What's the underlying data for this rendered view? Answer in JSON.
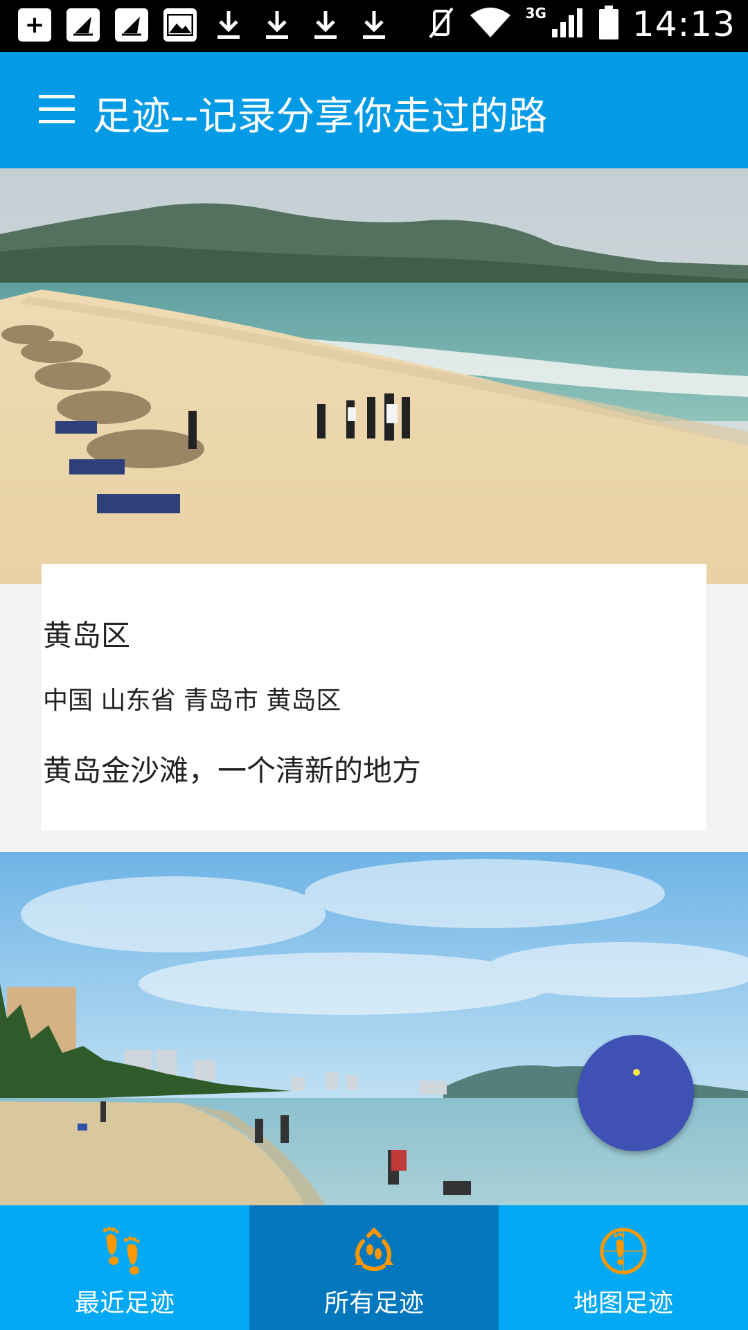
{
  "status_bar": {
    "time": "14:13",
    "network": "3G",
    "notification_icons": [
      "add-icon",
      "sailing-icon",
      "sailing-icon",
      "image-icon",
      "download-icon",
      "download-icon",
      "download-icon",
      "download-icon"
    ]
  },
  "app_bar": {
    "title": "足迹--记录分享你走过的路"
  },
  "cards": [
    {
      "title": "黄岛区",
      "address": "中国 山东省 青岛市 黄岛区",
      "description": "黄岛金沙滩，一个清新的地方"
    }
  ],
  "bottom_nav": {
    "items": [
      {
        "label": "最近足迹",
        "icon": "footprints-icon",
        "active": false
      },
      {
        "label": "所有足迹",
        "icon": "recycle-footprints-icon",
        "active": true
      },
      {
        "label": "地图足迹",
        "icon": "map-footprint-icon",
        "active": false
      }
    ]
  },
  "colors": {
    "primary": "#039be5",
    "nav_active": "#0277bd",
    "fab": "#3f51b5",
    "icon_orange": "#ff9800"
  }
}
